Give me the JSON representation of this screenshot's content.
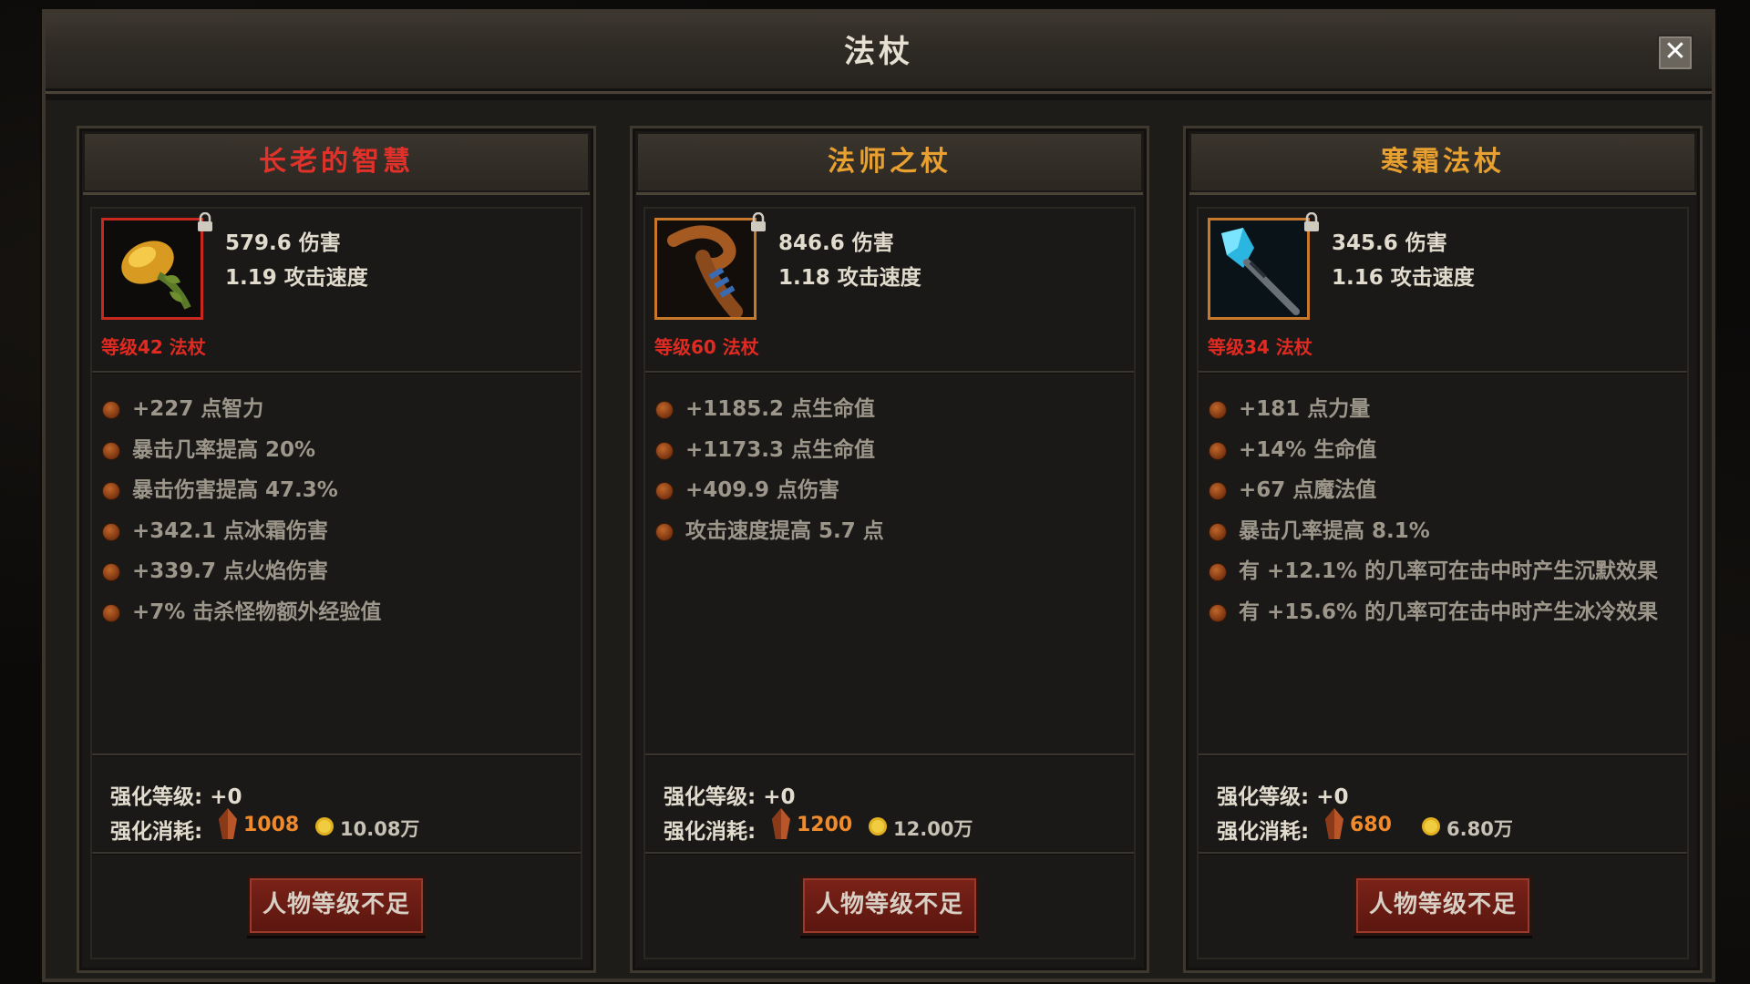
{
  "window": {
    "title": "法杖",
    "close_symbol": "✕"
  },
  "cards": [
    {
      "name": "长老的智慧",
      "name_color": "#e0322a",
      "icon": "golden-seed-staff-icon",
      "icon_border": "#c8281e",
      "damage": "579.6 伤害",
      "speed": "1.19 攻击速度",
      "level": "等级42  法杖",
      "attributes": [
        "+227 点智力",
        "暴击几率提高 20%",
        "暴击伤害提高 47.3%",
        "+342.1 点冰霜伤害",
        "+339.7 点火焰伤害",
        "+7% 击杀怪物额外经验值"
      ],
      "enhance_level_label": "强化等级:",
      "enhance_level_value": "+0",
      "enhance_cost_label": "强化消耗:",
      "crystal_cost": "1008",
      "coin_cost": "10.08万",
      "button": "人物等级不足"
    },
    {
      "name": "法师之杖",
      "name_color": "#e8a030",
      "icon": "curved-wooden-staff-icon",
      "icon_border": "#c8782a",
      "damage": "846.6 伤害",
      "speed": "1.18 攻击速度",
      "level": "等级60  法杖",
      "attributes": [
        "+1185.2 点生命值",
        "+1173.3 点生命值",
        "+409.9 点伤害",
        "攻击速度提高 5.7 点"
      ],
      "enhance_level_label": "强化等级:",
      "enhance_level_value": "+0",
      "enhance_cost_label": "强化消耗:",
      "crystal_cost": "1200",
      "coin_cost": "12.00万",
      "button": "人物等级不足"
    },
    {
      "name": "寒霜法杖",
      "name_color": "#e8a030",
      "icon": "ice-crystal-staff-icon",
      "icon_border": "#c8782a",
      "damage": "345.6 伤害",
      "speed": "1.16 攻击速度",
      "level": "等级34  法杖",
      "attributes": [
        "+181 点力量",
        "+14% 生命值",
        "+67 点魔法值",
        "暴击几率提高 8.1%",
        "有 +12.1% 的几率可在击中时产生沉默效果",
        "有 +15.6% 的几率可在击中时产生冰冷效果"
      ],
      "enhance_level_label": "强化等级:",
      "enhance_level_value": "+0",
      "enhance_cost_label": "强化消耗:",
      "crystal_cost": "680",
      "coin_cost": "6.80万",
      "button": "人物等级不足"
    }
  ]
}
